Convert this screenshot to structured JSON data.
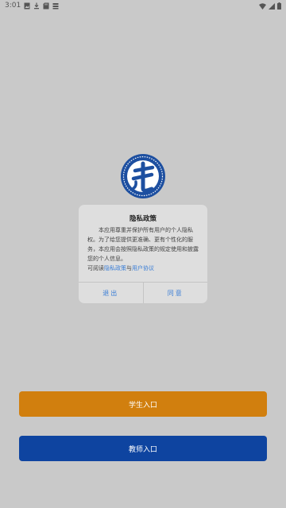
{
  "status_bar": {
    "time": "3:01",
    "left_icons": [
      "image-icon",
      "download-icon",
      "sd-card-icon",
      "storage-icon"
    ],
    "right_icons": [
      "wifi-icon",
      "signal-icon",
      "battery-icon"
    ]
  },
  "logo": {
    "name": "school-logo",
    "colors": {
      "primary": "#1d4fa0",
      "accent": "#ffffff"
    }
  },
  "dialog": {
    "title": "隐私政策",
    "body_text": "本应用尊重并保护所有用户的个人隐私权。为了给您提供更准确、更有个性化的服务，本应用会按照隐私政策的规定使用和披露您的个人信息。",
    "read_prefix": "可阅读",
    "privacy_link": "隐私政策",
    "and_text": "与",
    "agreement_link": "用户协议",
    "exit_label": "退出",
    "agree_label": "同意"
  },
  "buttons": {
    "student_label": "学生入口",
    "teacher_label": "教师入口"
  },
  "colors": {
    "background": "#c9c9c9",
    "student_button": "#d17f0e",
    "teacher_button": "#0e44a0",
    "link": "#3b7ed6"
  }
}
